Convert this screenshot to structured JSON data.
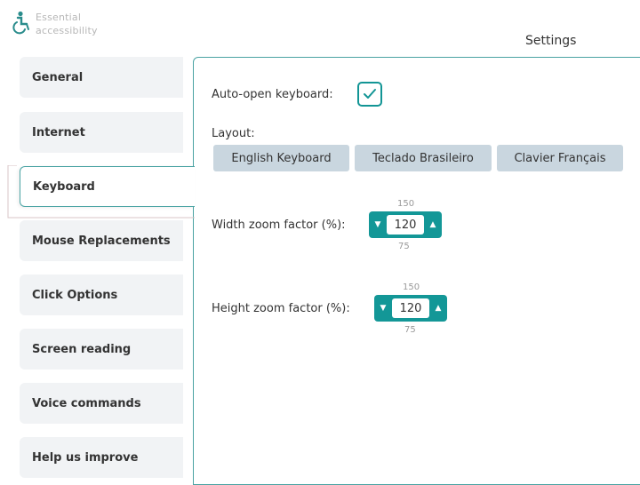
{
  "app": {
    "name_line1": "Essential",
    "name_line2": "accessibility",
    "logo_icon": "wheelchair-icon"
  },
  "page_title": "Settings",
  "sidebar": {
    "tabs": [
      {
        "label": "General",
        "active": false
      },
      {
        "label": "Internet",
        "active": false
      },
      {
        "label": "Keyboard",
        "active": true
      },
      {
        "label": "Mouse Replacements",
        "active": false
      },
      {
        "label": "Click Options",
        "active": false
      },
      {
        "label": "Screen reading",
        "active": false
      },
      {
        "label": "Voice commands",
        "active": false
      },
      {
        "label": "Help us improve",
        "active": false
      }
    ]
  },
  "keyboard": {
    "auto_open_label": "Auto-open keyboard:",
    "auto_open_checked": true,
    "layout_label": "Layout:",
    "layouts": [
      "English Keyboard",
      "Teclado Brasileiro",
      "Clavier Français"
    ],
    "width_zoom": {
      "label": "Width zoom factor (%):",
      "value": "120",
      "max": "150",
      "min": "75"
    },
    "height_zoom": {
      "label": "Height zoom factor (%):",
      "value": "120",
      "max": "150",
      "min": "75"
    }
  },
  "colors": {
    "accent": "#139797",
    "panel_border": "#4aa3a3",
    "tab_bg": "#f1f3f5",
    "layout_button_bg": "#c9d6df",
    "logo": "#2a8c8c"
  }
}
